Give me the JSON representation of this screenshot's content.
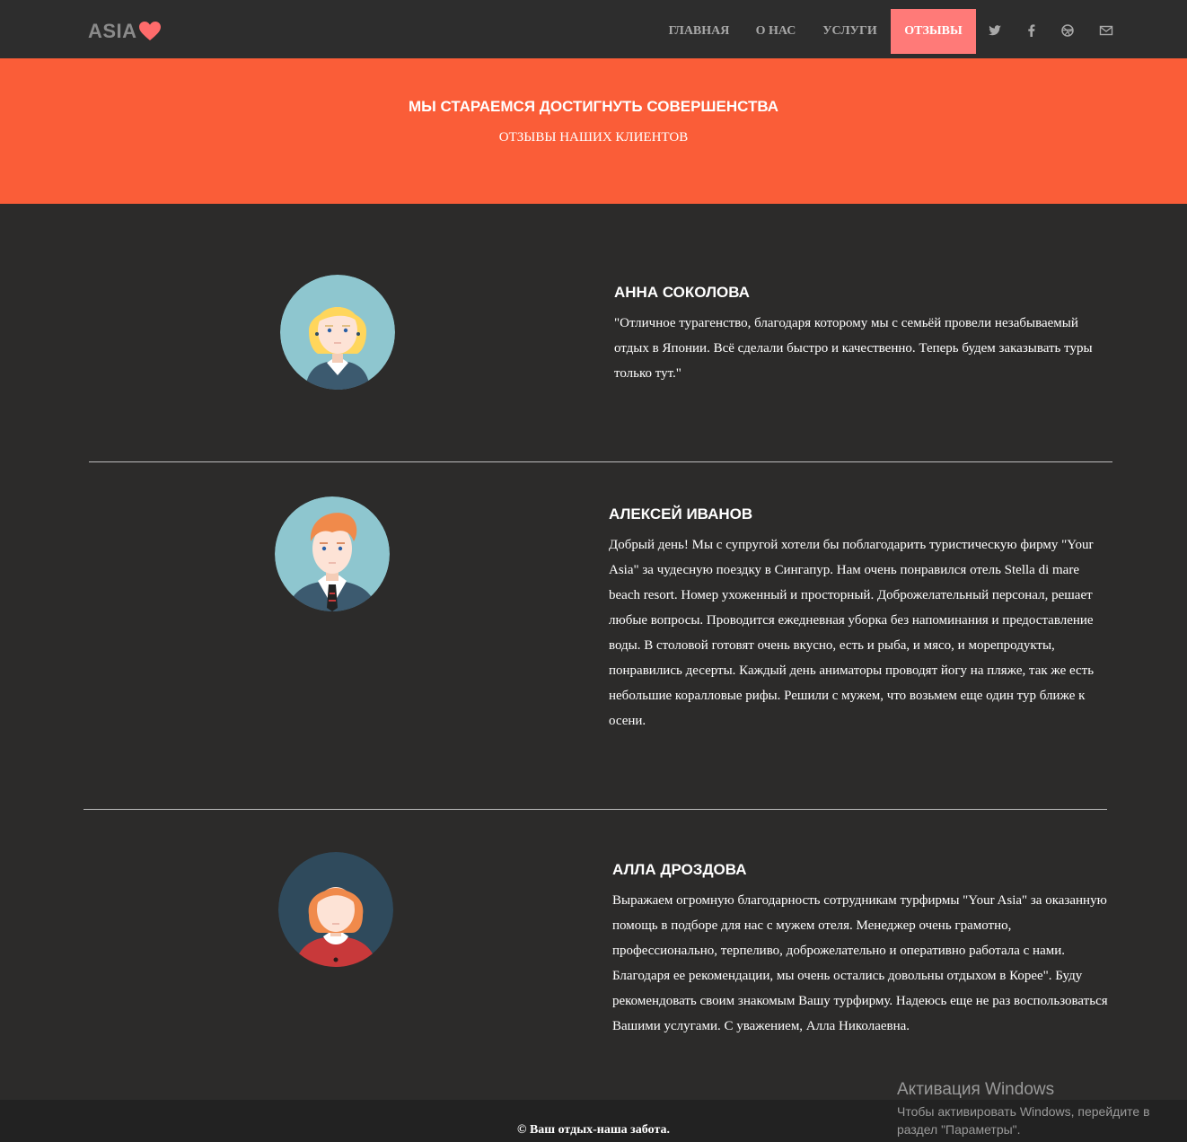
{
  "logo": {
    "text": "ASIA"
  },
  "nav": {
    "home": "ГЛАВНАЯ",
    "about": "О НАС",
    "services": "УСЛУГИ",
    "reviews": "ОТЗЫВЫ"
  },
  "social": [
    "twitter-icon",
    "facebook-icon",
    "dribbble-icon",
    "mail-icon"
  ],
  "hero": {
    "title": "МЫ СТАРАЕМСЯ ДОСТИГНУТЬ СОВЕРШЕНСТВА",
    "subtitle": "ОТЗЫВЫ НАШИХ КЛИЕНТОВ"
  },
  "reviews": [
    {
      "name": "АННА СОКОЛОВА",
      "text": "\"Отличное турагенство, благодаря которому мы с семьёй провели незабываемый отдых в Японии. Всё сделали быстро и качественно. Теперь будем заказывать туры только тут.\""
    },
    {
      "name": "АЛЕКСЕЙ ИВАНОВ",
      "text": "Добрый день! Мы с супругой хотели бы поблагодарить туристическую фирму \"Your Asia\" за чудесную поездку в Сингапур. Нам очень понравился отель Stella di mare beach resort. Номер ухоженный и просторный. Доброжелательный персонал, решает любые вопросы. Проводится ежедневная уборка без напоминания и предоставление воды. В столовой готовят очень вкусно, есть и рыба, и мясо, и морепродукты, понравились десерты. Каждый день аниматоры проводят йогу на пляже, так же есть небольшие коралловые рифы. Решили с мужем, что возьмем еще один тур ближе к осени."
    },
    {
      "name": "АЛЛА ДРОЗДОВА",
      "text": "Выражаем огромную благодарность сотрудникам турфирмы \"Your Asia\" за оказанную помощь в подборе для нас с мужем отеля. Менеджер очень грамотно, профессионально, терпеливо, доброжелательно и оперативно работала с нами. Благодаря ее рекомендации, мы очень остались довольны отдыхом в Корее\". Буду рекомендовать своим знакомым Вашу турфирму. Надеюсь еще не раз воспользоваться Вашими услугами. С уважением, Алла Николаевна."
    }
  ],
  "footer": {
    "text": "© Ваш отдых-наша забота."
  },
  "windows_activation": {
    "title": "Активация Windows",
    "line1": "Чтобы активировать Windows, перейдите в",
    "line2": "раздел \"Параметры\"."
  },
  "colors": {
    "topbar": "#2d2d2d",
    "background": "#2c2b2a",
    "hero": "#fa5d38",
    "nav_active": "#ff7a78",
    "heart": "#ff6b6b"
  }
}
